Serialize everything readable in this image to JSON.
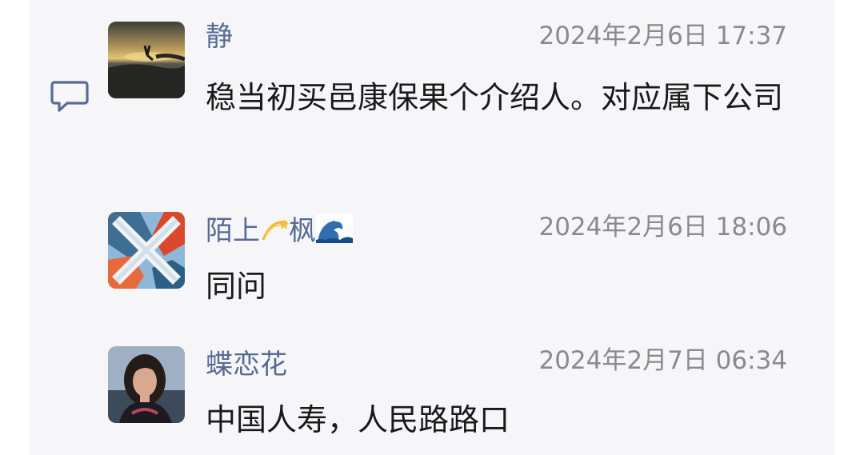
{
  "comments": [
    {
      "name": "静",
      "time": "2024年2月6日 17:37",
      "text": "稳当初买邑康保果个介绍人。对应属下公司",
      "avatar_icon": "sunset-beach-photo"
    },
    {
      "name": "陌上",
      "name_emoji_1": "dizzy-star-icon",
      "name_part2": "枫",
      "name_emoji_2": "water-wave-icon",
      "time": "2024年2月6日 18:06",
      "text": "同问",
      "avatar_icon": "abstract-x-art-photo"
    },
    {
      "name": "蝶恋花",
      "time": "2024年2月7日 06:34",
      "text": "中国人寿，人民路路口",
      "avatar_icon": "woman-portrait-photo"
    }
  ],
  "side_icon": "comment-bubble-icon",
  "colors": {
    "name": "#576b95",
    "time": "#8a8a8a",
    "text": "#191919",
    "panel": "#f6f6f8"
  }
}
